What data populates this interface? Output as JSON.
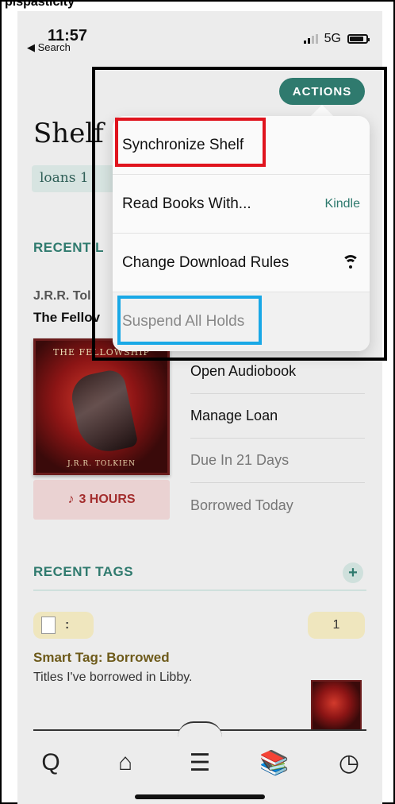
{
  "caption": "plspasticity",
  "status": {
    "time": "11:57",
    "back_label": "◀ Search",
    "network": "5G"
  },
  "page_title": "Shelf",
  "loans_chip": "loans 1",
  "recent_loans": {
    "section_title": "RECENT L",
    "author": "J.R.R. Tol",
    "book_title": "The Fellov",
    "cover_top_text": "THE FELLOWSHIP",
    "cover_bottom_text": "J.R.R. TOLKIEN",
    "hours_button": "3 HOURS",
    "rows": [
      "Open Audiobook",
      "Manage Loan",
      "Due In 21 Days",
      "Borrowed Today"
    ]
  },
  "actions": {
    "button_label": "ACTIONS",
    "menu": [
      {
        "label": "Synchronize Shelf"
      },
      {
        "label": "Read Books With...",
        "value": "Kindle"
      },
      {
        "label": "Change Download Rules",
        "icon": "wifi-icon"
      },
      {
        "label": "Suspend All Holds"
      }
    ]
  },
  "recent_tags": {
    "section_title": "RECENT TAGS",
    "add_label": "+",
    "tag_dots": ":",
    "tag_count": "1",
    "tag_title": "Smart Tag: Borrowed",
    "tag_description": "Titles I've borrowed in Libby."
  },
  "nav": {
    "items": [
      "search-icon",
      "library-icon",
      "menu-icon",
      "shelf-icon",
      "clock-icon"
    ],
    "glyphs": [
      "Q",
      "⌂",
      "☰",
      "📚",
      "◷"
    ]
  },
  "colors": {
    "accent": "#2f7a6e",
    "highlight_red": "#e0141e",
    "highlight_blue": "#19a8e6",
    "loan_button": "#a32d2d"
  }
}
